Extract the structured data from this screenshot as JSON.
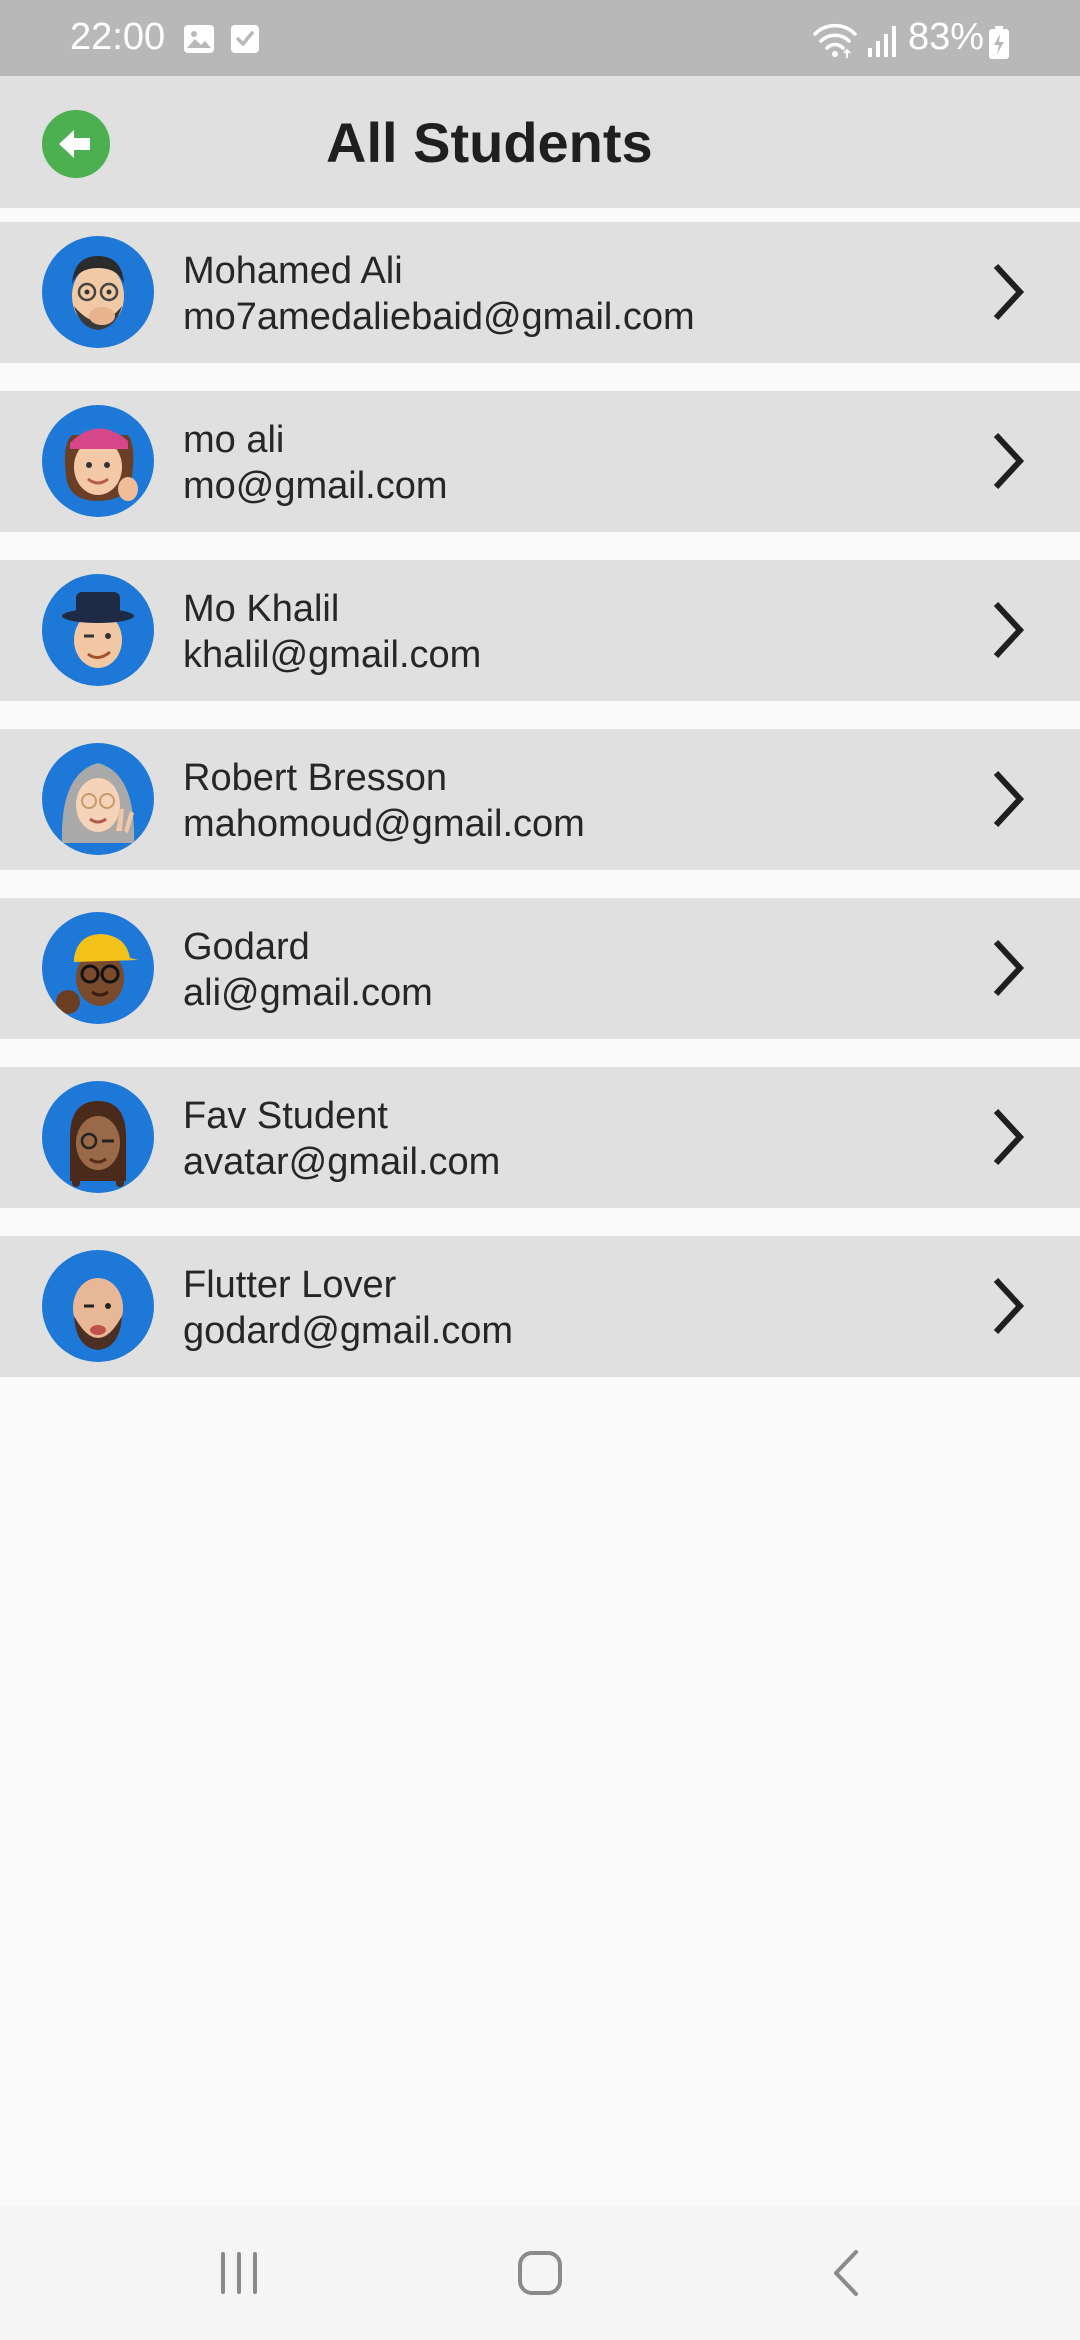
{
  "status_bar": {
    "time": "22:00",
    "battery": "83%",
    "icons": [
      "gallery-notification-icon",
      "checkbox-notification-icon",
      "wifi-icon",
      "signal-icon",
      "battery-charging-icon"
    ]
  },
  "app_bar": {
    "title": "All Students",
    "back_icon": "arrow-left-circle-icon",
    "accent_color": "#4caf50"
  },
  "students": [
    {
      "name": "Mohamed Ali",
      "email": "mo7amedaliebaid@gmail.com",
      "avatar": "memoji-man-glasses-hand-over-mouth"
    },
    {
      "name": "mo ali",
      "email": "mo@gmail.com",
      "avatar": "memoji-woman-pink-cap-thumbs-up"
    },
    {
      "name": "Mo Khalil",
      "email": "khalil@gmail.com",
      "avatar": "memoji-man-black-hat-wink"
    },
    {
      "name": "Robert Bresson",
      "email": "mahomoud@gmail.com",
      "avatar": "memoji-woman-grey-hair-peace-sign"
    },
    {
      "name": "Godard",
      "email": "ali@gmail.com",
      "avatar": "memoji-man-yellow-cap-glasses-fist"
    },
    {
      "name": "Fav Student",
      "email": "avatar@gmail.com",
      "avatar": "memoji-woman-braids-wink"
    },
    {
      "name": "Flutter Lover",
      "email": "godard@gmail.com",
      "avatar": "memoji-bald-man-beard-wink"
    }
  ],
  "row_icon": "chevron-right-icon",
  "avatar_bg": "#1e78d8",
  "nav_bar": {
    "icons": [
      "recent-apps-icon",
      "home-icon",
      "back-icon"
    ]
  }
}
